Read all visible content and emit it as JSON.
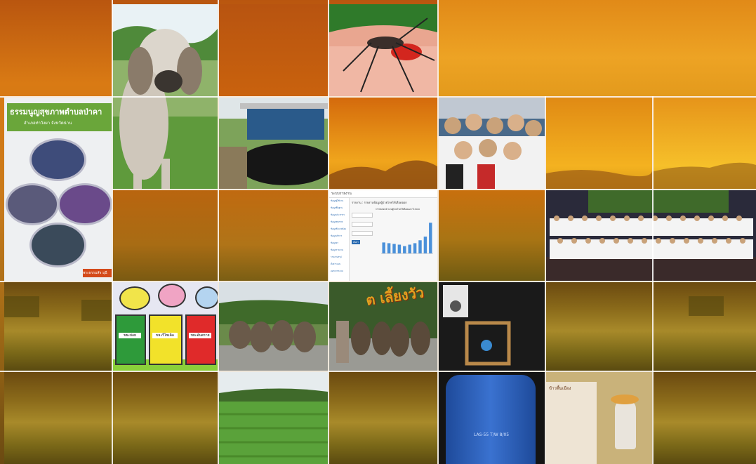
{
  "colors": {
    "sunset_top": "#c95a0c",
    "sunset_mid": "#e38a12",
    "field_dark": "#6b4a10",
    "green_banner": "#6aa63a",
    "report_bar": "#4a90d9"
  },
  "charter_card": {
    "title": "ธรรมนูญสุขภาพตำบลป่าคา",
    "subtitle": "อำเภอท่าวังผา จังหวัดน่าน",
    "footer": "พระธรรมสัจ มุนี"
  },
  "report_card": {
    "app_name": "ระบบรายงาน",
    "page_title": "รายงาน : รายงานข้อมูลผู้ป่วยโรคไข้เลือดออก",
    "chart_title": "กราฟแสดงจำนวนผู้ป่วยโรคไข้เลือดออก ปี 2560",
    "submit_label": "ค้นหา",
    "menu_items": [
      "ข้อมูลผู้ใช้งาน",
      "ข้อมูลพื้นฐาน",
      "ข้อมูลประชากร",
      "ข้อมูลสุขภาพ",
      "ข้อมูลสิ่งแวดล้อม",
      "ข้อมูลบริการ",
      "ข้อมูลยา",
      "ข้อมูลรายงาน",
      "รายงานสรุป",
      "ตั้งค่าระบบ",
      "ออกจากระบบ"
    ]
  },
  "chart_data": {
    "type": "bar",
    "title": "",
    "categories": [
      "1",
      "2",
      "3",
      "4",
      "5",
      "6",
      "7",
      "8",
      "9",
      "10"
    ],
    "values": [
      1.5,
      1.4,
      1.3,
      1.2,
      1.0,
      1.2,
      1.4,
      1.8,
      2.3,
      4.2
    ],
    "ylim": [
      0,
      5
    ]
  },
  "bins_card": {
    "green_label": "ขยะย่อย",
    "yellow_label": "ขยะรีไซเคิล",
    "red_label": "ขยะอันตราย"
  },
  "cattle_card": {
    "banner_text": "ต  เลี้ยงวัว"
  },
  "barrel_card": {
    "barrel_text": "LAS-55 T/W 8/05"
  },
  "rice_card": {
    "photo_label": "ข้าวพื้นเมือง"
  }
}
